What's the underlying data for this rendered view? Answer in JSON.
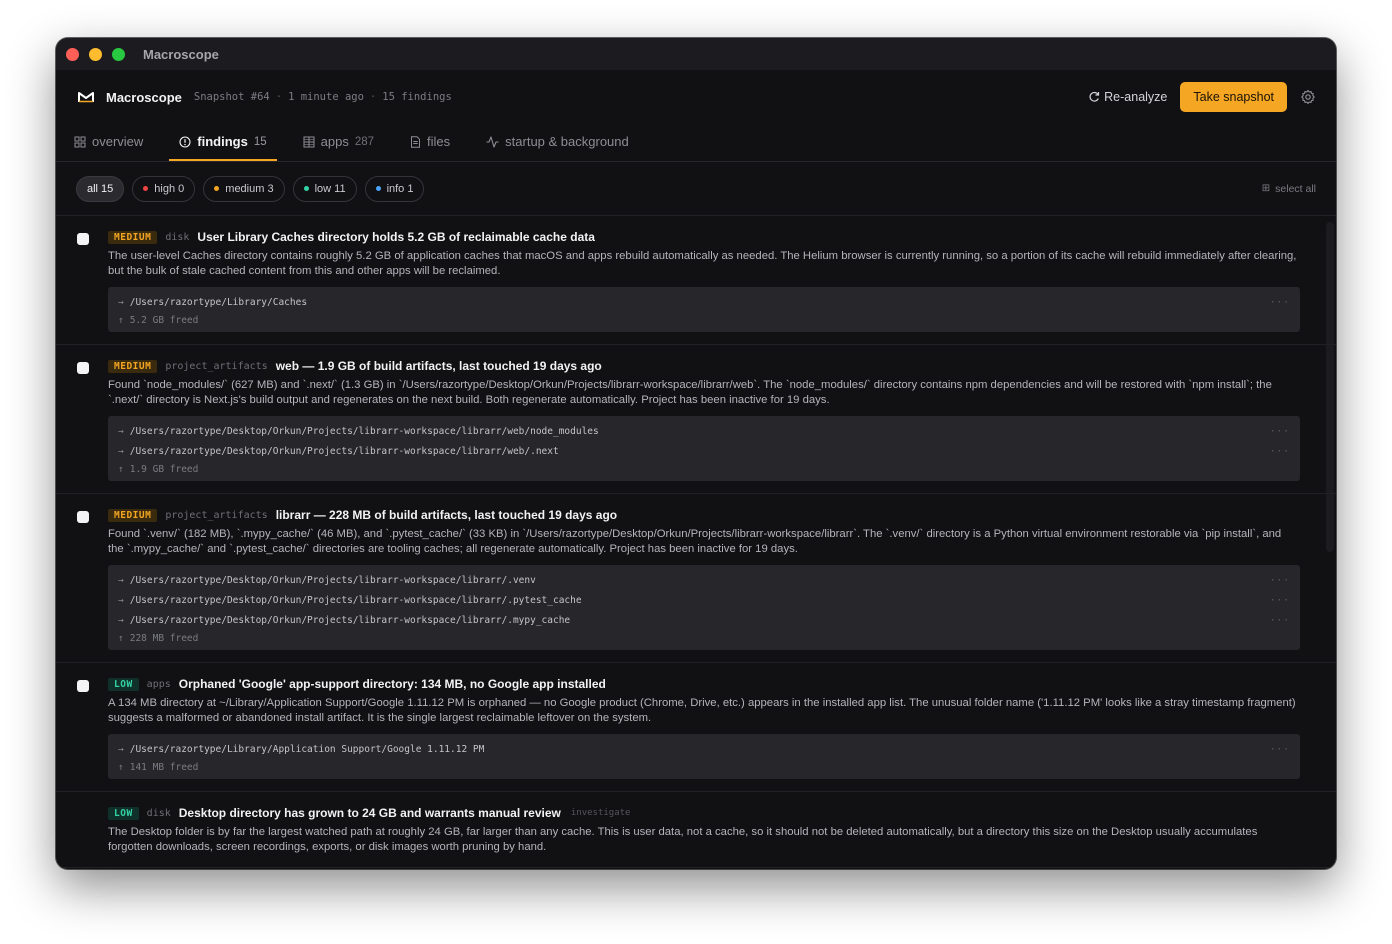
{
  "window": {
    "title": "Macroscope"
  },
  "header": {
    "brand": "Macroscope",
    "snapshot": "Snapshot #64",
    "time": "1 minute ago",
    "findings_count": "15 findings",
    "reanalyze_label": "Re-analyze",
    "take_snapshot_label": "Take snapshot"
  },
  "tabs": [
    {
      "label": "overview",
      "count": "",
      "icon": "grid-icon"
    },
    {
      "label": "findings",
      "count": "15",
      "icon": "alert-circle-icon"
    },
    {
      "label": "apps",
      "count": "287",
      "icon": "apps-grid-icon"
    },
    {
      "label": "files",
      "count": "",
      "icon": "file-icon"
    },
    {
      "label": "startup & background",
      "count": "",
      "icon": "activity-icon"
    }
  ],
  "filters": [
    {
      "label": "all 15",
      "color": ""
    },
    {
      "label": "high 0",
      "color": "#ef4444"
    },
    {
      "label": "medium 3",
      "color": "#f5a623"
    },
    {
      "label": "low 11",
      "color": "#34d3a6"
    },
    {
      "label": "info 1",
      "color": "#4aa3ff"
    }
  ],
  "select_all_label": "select all",
  "findings": [
    {
      "severity": "MEDIUM",
      "category": "disk",
      "title": "User Library Caches directory holds 5.2 GB of reclaimable cache data",
      "description": "The user-level Caches directory contains roughly 5.2 GB of application caches that macOS and apps rebuild automatically as needed. The Helium browser is currently running, so a portion of its cache will rebuild immediately after clearing, but the bulk of stale cached content from this and other apps will be reclaimed.",
      "paths": [
        "/Users/razortype/Library/Caches"
      ],
      "freed": "5.2 GB freed"
    },
    {
      "severity": "MEDIUM",
      "category": "project_artifacts",
      "title": "web — 1.9 GB of build artifacts, last touched 19 days ago",
      "description": "Found `node_modules/` (627 MB) and `.next/` (1.3 GB) in `/Users/razortype/Desktop/Orkun/Projects/librarr-workspace/librarr/web`. The `node_modules/` directory contains npm dependencies and will be restored with `npm install`; the `.next/` directory is Next.js's build output and regenerates on the next build. Both regenerate automatically. Project has been inactive for 19 days.",
      "paths": [
        "/Users/razortype/Desktop/Orkun/Projects/librarr-workspace/librarr/web/node_modules",
        "/Users/razortype/Desktop/Orkun/Projects/librarr-workspace/librarr/web/.next"
      ],
      "freed": "1.9 GB freed"
    },
    {
      "severity": "MEDIUM",
      "category": "project_artifacts",
      "title": "librarr — 228 MB of build artifacts, last touched 19 days ago",
      "description": "Found `.venv/` (182 MB), `.mypy_cache/` (46 MB), and `.pytest_cache/` (33 KB) in `/Users/razortype/Desktop/Orkun/Projects/librarr-workspace/librarr`. The `.venv/` directory is a Python virtual environment restorable via `pip install`, and the `.mypy_cache/` and `.pytest_cache/` directories are tooling caches; all regenerate automatically. Project has been inactive for 19 days.",
      "paths": [
        "/Users/razortype/Desktop/Orkun/Projects/librarr-workspace/librarr/.venv",
        "/Users/razortype/Desktop/Orkun/Projects/librarr-workspace/librarr/.pytest_cache",
        "/Users/razortype/Desktop/Orkun/Projects/librarr-workspace/librarr/.mypy_cache"
      ],
      "freed": "228 MB freed"
    },
    {
      "severity": "LOW",
      "category": "apps",
      "title": "Orphaned 'Google' app-support directory: 134 MB, no Google app installed",
      "description": "A 134 MB directory at ~/Library/Application Support/Google 1.11.12 PM is orphaned — no Google product (Chrome, Drive, etc.) appears in the installed app list. The unusual folder name ('1.11.12 PM' looks like a stray timestamp fragment) suggests a malformed or abandoned install artifact. It is the single largest reclaimable leftover on the system.",
      "paths": [
        "/Users/razortype/Library/Application Support/Google 1.11.12 PM"
      ],
      "freed": "141 MB freed"
    },
    {
      "severity": "LOW",
      "category": "disk",
      "title": "Desktop directory has grown to 24 GB and warrants manual review",
      "tag": "investigate",
      "description": "The Desktop folder is by far the largest watched path at roughly 24 GB, far larger than any cache. This is user data, not a cache, so it should not be deleted automatically, but a directory this size on the Desktop usually accumulates forgotten downloads, screen recordings, exports, or disk images worth pruning by hand.",
      "paths": [],
      "freed": ""
    }
  ]
}
